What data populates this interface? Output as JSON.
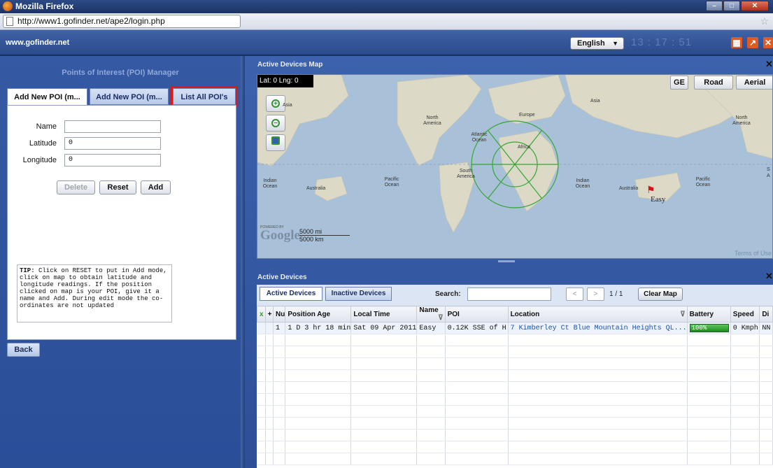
{
  "browser": {
    "title": "Mozilla Firefox",
    "url": "http://www1.gofinder.net/ape2/login.php",
    "window_buttons": [
      "minimize-icon",
      "maximize-icon",
      "close-icon"
    ]
  },
  "header": {
    "site": "www.gofinder.net",
    "language": "English",
    "clock": "13 : 17 : 51",
    "icons": [
      "layout-icon",
      "fullscreen-icon",
      "logout-icon"
    ]
  },
  "poi": {
    "title": "Points of Interest (POI) Manager",
    "tabs": [
      "Add New POI (m...",
      "Add New POI (m...",
      "List All POI's"
    ],
    "fields": [
      {
        "label": "Name",
        "value": ""
      },
      {
        "label": "Latitude",
        "value": "0"
      },
      {
        "label": "Longitude",
        "value": "0"
      }
    ],
    "buttons": {
      "delete": "Delete",
      "reset": "Reset",
      "add": "Add"
    },
    "tip_title": "TIP:",
    "tip_text": " Click on RESET to put in Add mode, click on map to obtain latitude and longitude readings. If the position clicked on map is your POI, give it a name and Add. During edit mode the co-ordinates are not updated",
    "back": "Back"
  },
  "map": {
    "title": "Active Devices Map",
    "latlng": "Lat: 0  Lng: 0",
    "types": [
      "GE",
      "Road",
      "Aerial"
    ],
    "labels": {
      "asia1": "Asia",
      "asia2": "Asia",
      "north_america1": "North America",
      "north_america2": "North America",
      "europe": "Europe",
      "atlantic": "Atlantic Ocean",
      "africa": "Africa",
      "south_america": "South America",
      "pacific1": "Pacific Ocean",
      "pacific2": "Pacific Ocean",
      "indian1": "Indian Ocean",
      "indian2": "Indian Ocean",
      "australia1": "Australia",
      "australia2": "Australia",
      "edge_s": "S",
      "edge_a": "A"
    },
    "marker_label": "Easy",
    "powered_by": "POWERED BY",
    "google": "Google",
    "scale_mi": "5000 mi",
    "scale_km": "5000 km",
    "terms": "Terms of Use"
  },
  "devices": {
    "title": "Active Devices",
    "tabs": [
      "Active Devices",
      "Inactive Devices"
    ],
    "search_label": "Search:",
    "search_value": "",
    "pages": "1 / 1",
    "clear_map": "Clear Map",
    "columns": [
      "x",
      "+",
      "Nu",
      "Position Age",
      "Local Time",
      "Name",
      "POI",
      "Location",
      "Battery",
      "Speed",
      "Di"
    ],
    "rows": [
      {
        "x": "",
        "plus": "",
        "num": "1",
        "age": "1 D 3 hr 18 min",
        "time": "Sat 09 Apr 2011",
        "name": "Easy",
        "poi": "0.12K SSE of H",
        "location": "7 Kimberley Ct Blue Mountain Heights QL...",
        "battery": "100%",
        "speed": "0 Kmph",
        "dir": "NN"
      }
    ]
  }
}
